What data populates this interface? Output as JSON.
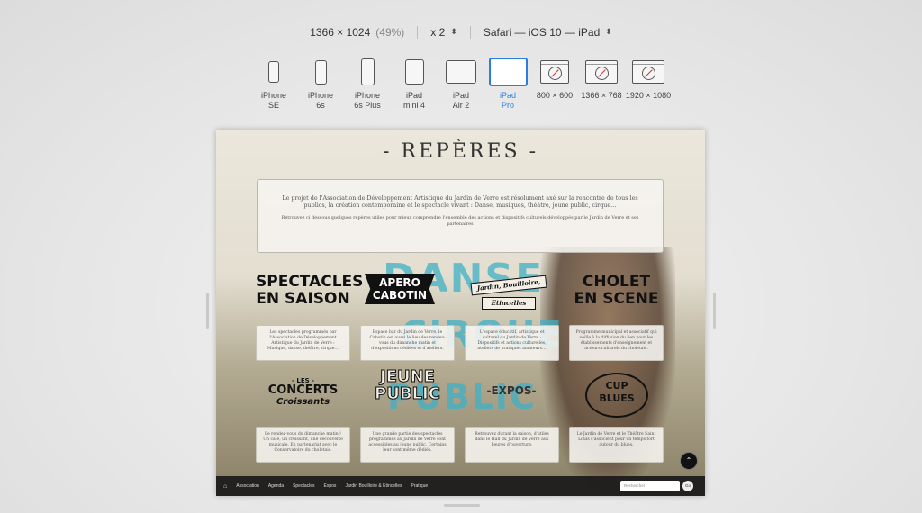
{
  "toolbar": {
    "resolution": "1366 × 1024",
    "scale_pct": "(49%)",
    "pixel_ratio": "x 2",
    "browser": "Safari — iOS 10 — iPad"
  },
  "devices": [
    {
      "l1": "iPhone",
      "l2": "SE"
    },
    {
      "l1": "iPhone",
      "l2": "6s"
    },
    {
      "l1": "iPhone",
      "l2": "6s Plus"
    },
    {
      "l1": "iPad",
      "l2": "mini 4"
    },
    {
      "l1": "iPad",
      "l2": "Air 2"
    },
    {
      "l1": "iPad",
      "l2": "Pro"
    },
    {
      "l1": "800 × 600",
      "l2": ""
    },
    {
      "l1": "1366 × 768",
      "l2": ""
    },
    {
      "l1": "1920 × 1080",
      "l2": ""
    }
  ],
  "selected_device": "iPad Pro",
  "site": {
    "title": "- REPÈRES -",
    "intro_main": "Le projet de l'Association de Développement Artistique du Jardin de Verre est résolument axé sur la rencontre de tous les publics, la création contemporaine et le spectacle vivant : Danse, musiques, théâtre, jeune public, cirque…",
    "intro_small": "Retrouvez ci dessous quelques repères utiles pour mieux comprendre l'ensemble des actions et dispositifs culturels développés par le Jardin de Verre et ses partenaires",
    "logos": {
      "spectacles1": "SPECTACLES",
      "spectacles2": "EN SAISON",
      "apero1": "APERO",
      "apero2": "CABOTIN",
      "jardin1": "Jardin, Bouilloire,",
      "jardin2": "Etincelles",
      "cholet1": "CHOLET",
      "cholet2": "EN SCENE",
      "concerts1": "- LES -",
      "concerts2": "CONCERTS",
      "concerts3": "Croissants",
      "jeune1": "JEUNE",
      "jeune2": "PUBLIC",
      "expos": "-EXPOS-",
      "cup1": "CUP",
      "cup2": "BLUES"
    },
    "cards": [
      "Les spectacles programmés par l'Association de Développement Artistique du Jardin de Verre : Musique, danse, théâtre, cirque…",
      "Espace bar du Jardin de Verre, le Cabotin est aussi le lieu des rendez-vous du dimanche matin et d'expositions dédiées et d'ateliers.",
      "L'espace éducatif, artistique et culturel du Jardin de Verre : Dispositifs et actions culturelles, ateliers de pratiques amateurs…",
      "Programme municipal et associatif qui veille à la diffusion du lien pour les établissements d'enseignement et acteurs culturels du choletais.",
      "Le rendez-vous du dimanche matin ! Un café, un croissant, une découverte musicale. En partenariat avec le Conservatoire du choletais.",
      "Une grande partie des spectacles programmés au Jardin de Verre sont accessibles au jeune public. Certains leur sont même dédiés.",
      "Retrouvez durant la saison, d'utiles dans le Hall du Jardin de Verre aux heures d'ouverture.",
      "Le Jardin de Verre et le Théâtre Saint Louis s'associent pour un temps fort autour du blues."
    ],
    "nav": [
      "Association",
      "Agenda",
      "Spectacles",
      "Expos",
      "Jardin Bouilloire & Etincelles",
      "Pratique"
    ],
    "search_placeholder": "Rechercher",
    "go_label": "Go",
    "bg_words": {
      "w1": "DANSE",
      "w2": "CIRQUE",
      "w3": "PUBLIC"
    }
  },
  "colors": {
    "accent": "#2a7de1",
    "teal": "#3fb1c6"
  }
}
